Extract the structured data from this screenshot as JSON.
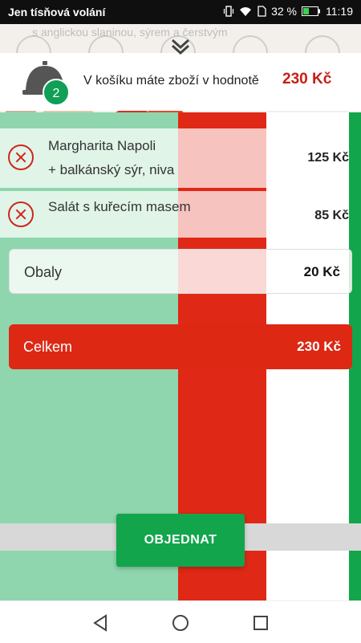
{
  "status_bar": {
    "carrier": "Jen tísňová volání",
    "battery": "32 %",
    "time": "11:19"
  },
  "background_text": "s anglickou slaninou, sýrem a čerstvým",
  "cart": {
    "item_count": "2",
    "summary_text": "V košíku máte zboží v hodnotě",
    "summary_total": "230 Kč"
  },
  "items": [
    {
      "name": "Margharita Napoli",
      "extra": "+ balkánský sýr, niva",
      "price": "125 Kč"
    },
    {
      "name": "Salát s kuřecím masem",
      "extra": "",
      "price": "85 Kč"
    }
  ],
  "packaging": {
    "label": "Obaly",
    "value": "20 Kč"
  },
  "total": {
    "label": "Celkem",
    "value": "230 Kč"
  },
  "order_button": "OBJEDNAT",
  "colors": {
    "accent_green": "#12a54c",
    "accent_red": "#dd2814",
    "price_red": "#c62015"
  },
  "icons": [
    "bell-icon",
    "remove-icon",
    "chevron-down-icon",
    "back-icon",
    "home-icon",
    "recent-apps-icon"
  ]
}
